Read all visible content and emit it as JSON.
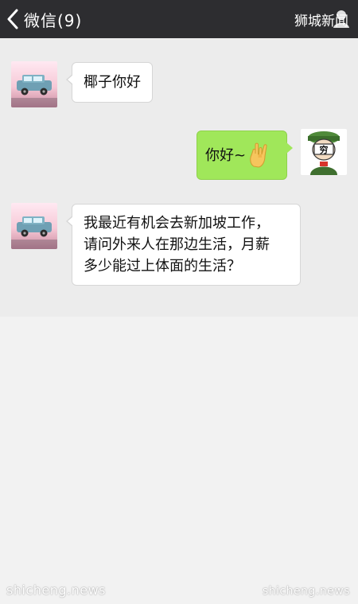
{
  "header": {
    "back_title": "微信(9)",
    "brand": "狮城新闻"
  },
  "messages": [
    {
      "side": "left",
      "text": "椰子你好",
      "avatar": "toy-car-avatar"
    },
    {
      "side": "right",
      "text": "你好~",
      "emoji": "rock-hand-emoji",
      "avatar": "cartoon-poor-avatar",
      "avatar_badge": "穷"
    },
    {
      "side": "left",
      "lines": [
        "我最近有机会去新加坡工作，",
        "请问外来人在那边生活，月薪",
        "多少能过上体面的生活？"
      ],
      "avatar": "toy-car-avatar"
    }
  ],
  "watermarks": {
    "left": "shicheng.news",
    "right": "shicheng.news"
  },
  "colors": {
    "topbar": "#2d2d30",
    "chat_bg": "#ececec",
    "bubble_right": "#a0e75a",
    "bubble_left": "#ffffff"
  }
}
